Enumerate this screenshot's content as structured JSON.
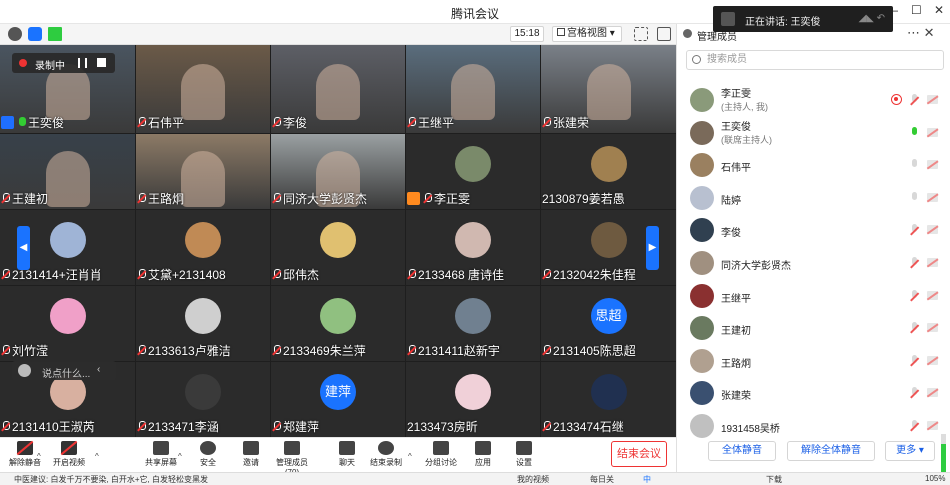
{
  "window": {
    "title": "腾讯会议",
    "minimize": "—",
    "maximize": "☐",
    "close": "✕"
  },
  "speaking": {
    "text": "正在讲话: 王奕俊"
  },
  "topbar": {
    "timer": "15:18",
    "view_label": "宫格视图",
    "view_caret": "▾"
  },
  "recording": {
    "label": "录制中"
  },
  "tiles": [
    {
      "name": "王奕俊",
      "host": true,
      "mic": "on",
      "bg": "#4a5560"
    },
    {
      "name": "石伟平",
      "mic": "muted",
      "bg": "#6b5a48"
    },
    {
      "name": "李俊",
      "mic": "muted",
      "bg": "#5d5f66"
    },
    {
      "name": "王继平",
      "mic": "muted",
      "bg": "#5a6d7d"
    },
    {
      "name": "张建荣",
      "mic": "muted",
      "bg": "#7a8088"
    },
    {
      "name": "王建初",
      "mic": "muted",
      "bg": "#38414a"
    },
    {
      "name": "王路炯",
      "mic": "muted",
      "bg": "#8c7a66"
    },
    {
      "name": "同济大学彭贤杰",
      "mic": "muted",
      "bg": "#9aa0a2"
    },
    {
      "name": "李正雯",
      "orange": true,
      "mic": "muted",
      "avatar_color": "#7a8a6a"
    },
    {
      "name": "2130879姜若愚",
      "mic": "none",
      "avatar_color": "#a08050"
    },
    {
      "name": "2131414+汪肖肖",
      "mic": "muted",
      "avatar_color": "#9fb4d6"
    },
    {
      "name": "艾黛+2131408",
      "mic": "muted",
      "avatar_color": "#c08a55"
    },
    {
      "name": "邱伟杰",
      "mic": "muted",
      "avatar_color": "#e0c070"
    },
    {
      "name": "2133468 唐诗佳",
      "mic": "muted",
      "avatar_color": "#d0b8b0"
    },
    {
      "name": "2132042朱佳程",
      "mic": "muted",
      "avatar_color": "#6e5a40"
    },
    {
      "name": "刘竹滢",
      "mic": "muted",
      "avatar_color": "#f0a0c8"
    },
    {
      "name": "2133613卢雅洁",
      "mic": "muted",
      "avatar_color": "#cfcfcf"
    },
    {
      "name": "2133469朱兰萍",
      "mic": "muted",
      "avatar_color": "#90c080"
    },
    {
      "name": "2131411赵新宇",
      "mic": "muted",
      "avatar_color": "#708090"
    },
    {
      "name": "2131405陈思超",
      "mic": "muted",
      "avatar_text": "思超"
    },
    {
      "name": "2131410王淑芮",
      "mic": "muted",
      "avatar_color": "#d8b0a0"
    },
    {
      "name": "2133471李涵",
      "mic": "muted",
      "avatar_color": "#3a3a3a"
    },
    {
      "name": "郑建萍",
      "mic": "muted",
      "avatar_text": "建萍"
    },
    {
      "name": "2133473房昕",
      "mic": "none",
      "avatar_color": "#f0d0d8"
    },
    {
      "name": "2133474石继",
      "mic": "muted",
      "avatar_color": "#203050"
    }
  ],
  "chat": {
    "placeholder": "说点什么..."
  },
  "toolbar": [
    {
      "label": "解除静音",
      "icon": "mic-muted-icon"
    },
    {
      "label": "开启视频",
      "icon": "camera-off-icon"
    },
    {
      "label": "共享屏幕",
      "icon": "share-screen-icon"
    },
    {
      "label": "安全",
      "icon": "shield-icon"
    },
    {
      "label": "邀请",
      "icon": "invite-icon"
    },
    {
      "label": "管理成员(70)",
      "icon": "members-icon"
    },
    {
      "label": "聊天",
      "icon": "chat-icon"
    },
    {
      "label": "结束录制",
      "icon": "stop-record-icon"
    },
    {
      "label": "分组讨论",
      "icon": "breakout-icon"
    },
    {
      "label": "应用",
      "icon": "apps-icon"
    },
    {
      "label": "设置",
      "icon": "gear-icon"
    }
  ],
  "end_button": "结束会议",
  "panel": {
    "title": "管理成员",
    "search_placeholder": "搜索成员",
    "members": [
      {
        "name": "李正雯",
        "sub": "(主持人, 我)",
        "mic": "muted",
        "rec": true
      },
      {
        "name": "王奕俊",
        "sub": "(联席主持人)",
        "mic": "on"
      },
      {
        "name": "石伟平",
        "mic": "idle"
      },
      {
        "name": "陆婷",
        "mic": "idle"
      },
      {
        "name": "李俊",
        "mic": "muted"
      },
      {
        "name": "同济大学彭贤杰",
        "mic": "muted"
      },
      {
        "name": "王继平",
        "mic": "muted"
      },
      {
        "name": "王建初",
        "mic": "muted"
      },
      {
        "name": "王路炯",
        "mic": "muted"
      },
      {
        "name": "张建荣",
        "mic": "muted"
      },
      {
        "name": "1931458吴桥",
        "mic": "muted"
      }
    ],
    "mute_all": "全体静音",
    "unmute_all": "解除全体静音",
    "more": "更多 ▾"
  },
  "statusbar": {
    "left": "中医建议: 白发千万不要染, 白开水+它, 白发轻松变黑发",
    "video": "我的视频",
    "daily": "每日关",
    "ime": "中",
    "download": "下载",
    "zoom": "105%"
  }
}
